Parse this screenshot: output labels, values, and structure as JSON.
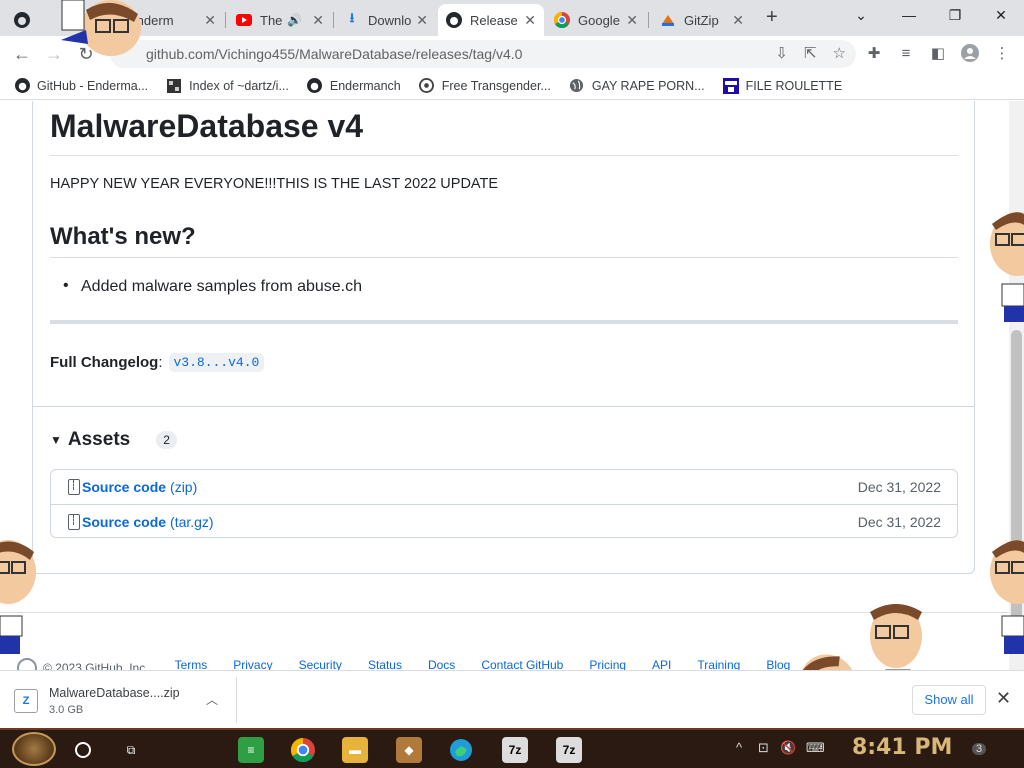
{
  "browser": {
    "tabs": [
      {
        "title": "Enderm",
        "icon": "github-icon",
        "active": false
      },
      {
        "title": "The",
        "icon": "youtube-icon",
        "active": false,
        "audio": true
      },
      {
        "title": "Downlo",
        "icon": "download-icon",
        "active": false
      },
      {
        "title": "Release",
        "icon": "github-icon",
        "active": true
      },
      {
        "title": "Google",
        "icon": "chrome-icon",
        "active": false
      },
      {
        "title": "GitZip",
        "icon": "gitzip-icon",
        "active": false
      }
    ],
    "new_tab": "+",
    "window_controls": {
      "minimize": "—",
      "restore": "❐",
      "close": "✕"
    },
    "url": "github.com/Vichingo455/MalwareDatabase/releases/tag/v4.0",
    "bookmarks": [
      {
        "label": "GitHub - Enderma...",
        "icon": "github-icon"
      },
      {
        "label": "Index of ~dartz/i...",
        "icon": "folder-icon"
      },
      {
        "label": "Endermanch",
        "icon": "github-icon"
      },
      {
        "label": "Free Transgender...",
        "icon": "site-icon"
      },
      {
        "label": "GAY RAPE PORN...",
        "icon": "globe-icon"
      },
      {
        "label": "FILE ROULETTE",
        "icon": "roulette-icon"
      }
    ]
  },
  "release": {
    "title": "MalwareDatabase v4",
    "message": "HAPPY NEW YEAR EVERYONE!!!THIS IS THE LAST 2022 UPDATE",
    "whats_new_heading": "What's new?",
    "items": [
      "Added malware samples from abuse.ch"
    ],
    "changelog_label": "Full Changelog",
    "changelog_colon": ":",
    "changelog_link": "v3.8...v4.0",
    "assets_heading": "Assets",
    "assets_count": "2",
    "assets": [
      {
        "name": "Source code",
        "type": "(zip)",
        "date": "Dec 31, 2022"
      },
      {
        "name": "Source code",
        "type": "(tar.gz)",
        "date": "Dec 31, 2022"
      }
    ]
  },
  "footer": {
    "copyright": "© 2023 GitHub, Inc.",
    "links": [
      "Terms",
      "Privacy",
      "Security",
      "Status",
      "Docs",
      "Contact GitHub",
      "Pricing",
      "API",
      "Training",
      "Blog"
    ]
  },
  "downloads": {
    "filename": "MalwareDatabase....zip",
    "size": "3.0 GB",
    "show_all": "Show all",
    "close": "✕"
  },
  "taskbar": {
    "clock": "8:41 PM",
    "notifications": "3"
  },
  "colors": {
    "link": "#0969da",
    "chrome_blue": "#1a73e8",
    "taskbar_bg": "#2a1a12"
  }
}
